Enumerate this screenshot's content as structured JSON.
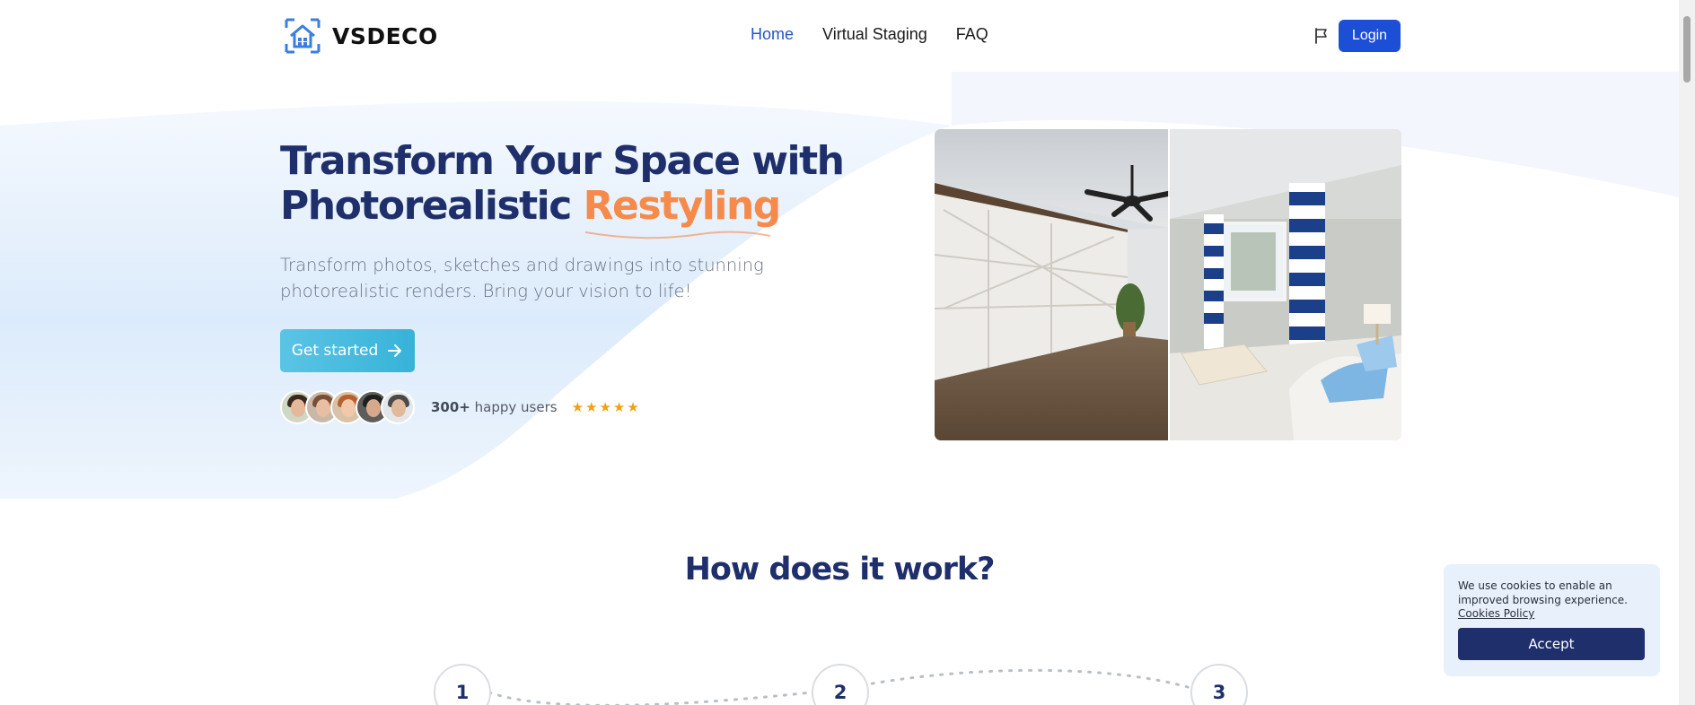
{
  "brand": {
    "name": "VSDECO"
  },
  "nav": [
    {
      "label": "Home",
      "active": true
    },
    {
      "label": "Virtual Staging",
      "active": false
    },
    {
      "label": "FAQ",
      "active": false
    }
  ],
  "header": {
    "login_label": "Login",
    "language_icon": "flag-icon"
  },
  "hero": {
    "title_line1": "Transform Your Space with",
    "title_line2_prefix": "Photorealistic ",
    "title_accent": "Restyling",
    "subtitle": "Transform photos, sketches and drawings into stunning photorealistic renders. Bring your vision to life!",
    "cta_label": "Get started",
    "cta_icon": "arrow-right-icon",
    "users_count": "300+",
    "users_label": " happy users",
    "stars": "★★★★★",
    "rating": 5
  },
  "how": {
    "title": "How does it work?",
    "steps": [
      "1",
      "2",
      "3"
    ]
  },
  "cookie": {
    "text": "We use cookies to enable an improved browsing experience.",
    "link": "Cookies Policy",
    "accept_label": "Accept"
  },
  "colors": {
    "navy": "#1e2f6b",
    "accent_orange": "#f58a4b",
    "primary_blue": "#1d4fd6",
    "cta_teal": "#36b3d8",
    "star_gold": "#f0a10f"
  }
}
